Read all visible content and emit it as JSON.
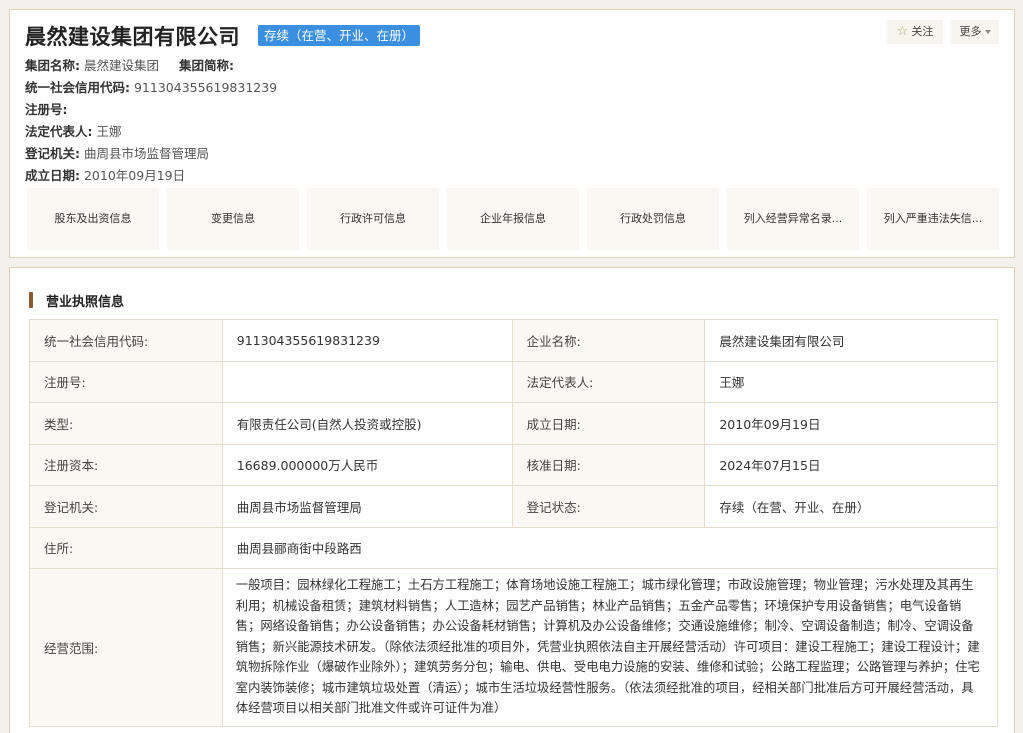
{
  "header": {
    "company_name": "晨然建设集团有限公司",
    "status": "存续（在营、开业、在册）",
    "follow_label": "关注",
    "more_label": "更多",
    "group_name_label": "集团名称:",
    "group_name": "晨然建设集团",
    "group_short_label": "集团简称:",
    "group_short": "",
    "credit_code_label": "统一社会信用代码:",
    "credit_code": "911304355619831239",
    "reg_no_label": "注册号:",
    "reg_no": "",
    "legal_rep_label": "法定代表人:",
    "legal_rep": "王娜",
    "authority_label": "登记机关:",
    "authority": "曲周县市场监督管理局",
    "founded_label": "成立日期:",
    "founded": "2010年09月19日"
  },
  "tabs": [
    {
      "label": "股东及出资信息"
    },
    {
      "label": "变更信息"
    },
    {
      "label": "行政许可信息"
    },
    {
      "label": "企业年报信息"
    },
    {
      "label": "行政处罚信息"
    },
    {
      "label": "列入经营异常名录..."
    },
    {
      "label": "列入严重违法失信..."
    }
  ],
  "section": {
    "title": "营业执照信息"
  },
  "license": {
    "credit_code_label": "统一社会信用代码:",
    "credit_code": "911304355619831239",
    "name_label": "企业名称:",
    "name": "晨然建设集团有限公司",
    "reg_no_label": "注册号:",
    "reg_no": "",
    "legal_rep_label": "法定代表人:",
    "legal_rep": "王娜",
    "type_label": "类型:",
    "type": "有限责任公司(自然人投资或控股)",
    "founded_label": "成立日期:",
    "founded": "2010年09月19日",
    "capital_label": "注册资本:",
    "capital": "16689.000000万人民币",
    "approved_label": "核准日期:",
    "approved": "2024年07月15日",
    "authority_label": "登记机关:",
    "authority": "曲周县市场监督管理局",
    "reg_status_label": "登记状态:",
    "reg_status": "存续（在营、开业、在册）",
    "address_label": "住所:",
    "address": "曲周县郦商街中段路西",
    "scope_label": "经营范围:",
    "scope": "一般项目：园林绿化工程施工；土石方工程施工；体育场地设施工程施工；城市绿化管理；市政设施管理；物业管理；污水处理及其再生利用；机械设备租赁；建筑材料销售；人工造林；园艺产品销售；林业产品销售；五金产品零售；环境保护专用设备销售；电气设备销售；网络设备销售；办公设备销售；办公设备耗材销售；计算机及办公设备维修；交通设施维修；制冷、空调设备制造；制冷、空调设备销售；新兴能源技术研发。（除依法须经批准的项目外，凭营业执照依法自主开展经营活动）许可项目：建设工程施工；建设工程设计；建筑物拆除作业（爆破作业除外）；建筑劳务分包；输电、供电、受电电力设施的安装、维修和试验；公路工程监理；公路管理与养护；住宅室内装饰装修；城市建筑垃圾处置（清运）；城市生活垃圾经营性服务。（依法须经批准的项目，经相关部门批准后方可开展经营活动，具体经营项目以相关部门批准文件或许可证件为准）"
  },
  "colors": {
    "badge": "#3b8fe0",
    "border": "#e2d2b4",
    "accent": "#8a5a2e"
  }
}
